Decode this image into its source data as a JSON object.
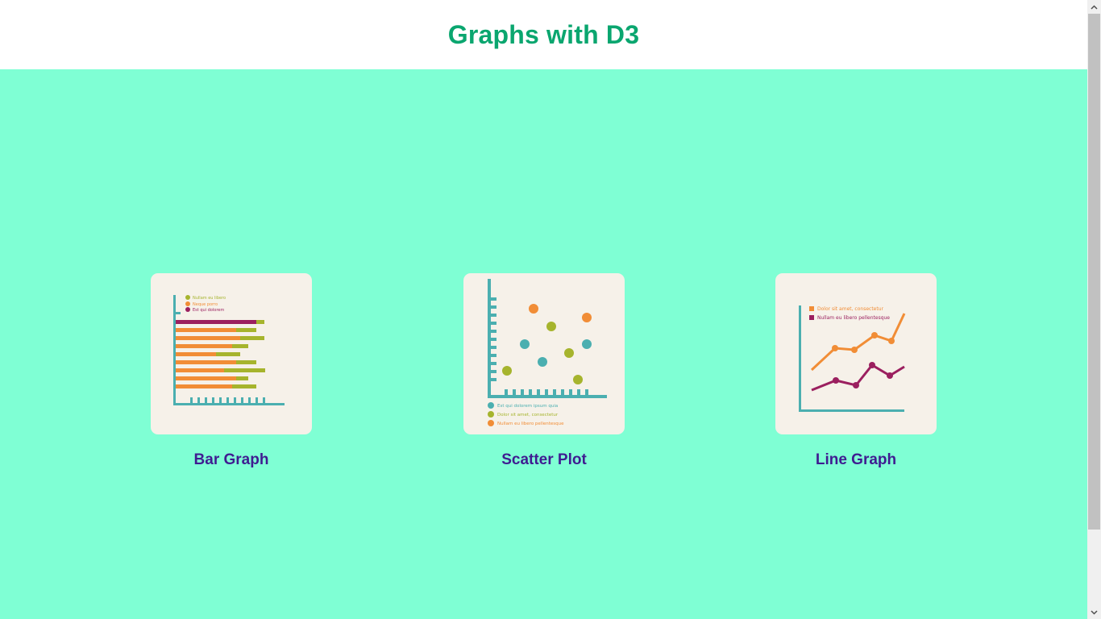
{
  "header": {
    "title": "Graphs with D3"
  },
  "cards": [
    {
      "caption": "Bar Graph",
      "icon": "bar-graph-thumbnail",
      "legend": [
        "Nullam eu libero",
        "Neque porro",
        "Est qui dolorem"
      ]
    },
    {
      "caption": "Scatter Plot",
      "icon": "scatter-plot-thumbnail",
      "legend": [
        "Est qui dolorem ipsum quia",
        "Dolor sit amet, consectetur",
        "Nullam eu libero pellentesque"
      ]
    },
    {
      "caption": "Line Graph",
      "icon": "line-graph-thumbnail",
      "legend": [
        "Dolor sit amet, consectetur",
        "Nullam eu libero pellentesque"
      ]
    }
  ],
  "colors": {
    "title": "#0aa66f",
    "background": "#7fffd4",
    "caption": "#3f1c91",
    "thumb_bg": "#f6f1e9",
    "teal": "#4bafb0",
    "olive": "#a6b42d",
    "orange": "#f18d36",
    "purple": "#9b1f5f"
  }
}
